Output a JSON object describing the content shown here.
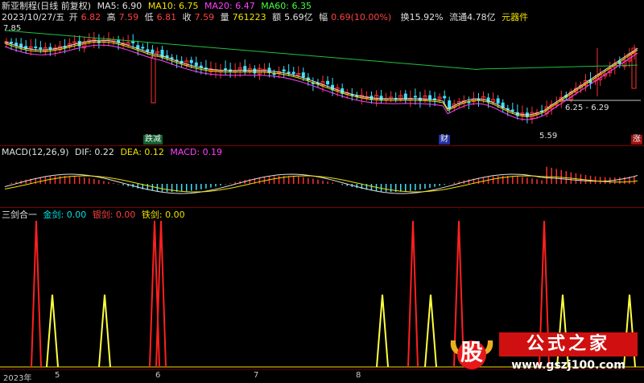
{
  "title": "新亚制程(日线 前复权)",
  "ma": {
    "ma5": "MA5: 6.90",
    "ma10": "MA10: 6.75",
    "ma20": "MA20: 6.47",
    "ma60": "MA60: 6.35"
  },
  "quote": {
    "date": "2023/10/27/五",
    "open_label": "开",
    "open": "6.82",
    "high_label": "高",
    "high": "7.59",
    "low_label": "低",
    "low": "6.81",
    "close_label": "收",
    "close": "7.59",
    "vol_label": "量",
    "vol": "761223",
    "amt_label": "额",
    "amt": "5.69亿",
    "chg_label": "幅",
    "chg": "0.69(10.00%)",
    "turnover": "换15.92%",
    "float": "流通4.78亿",
    "sector": "元器件"
  },
  "price_labels": {
    "top": "7.85",
    "range": "6.25 - 6.29",
    "low": "5.59"
  },
  "tags": {
    "t1": "跌减",
    "t2": "财",
    "t3": "涨"
  },
  "macd": {
    "name": "MACD(12,26,9)",
    "dif": "DIF: 0.22",
    "dea": "DEA: 0.12",
    "macd": "MACD: 0.19"
  },
  "sword": {
    "name": "三剑合一",
    "gold": "金剑: 0.00",
    "silver": "银剑: 0.00",
    "iron": "铁剑: 0.00"
  },
  "dates": {
    "year": "2023年",
    "m5": "5",
    "m6": "6",
    "m7": "7",
    "m8": "8"
  },
  "logo": {
    "gu": "股",
    "text": "公式之家",
    "url": "www.gszj100.com"
  },
  "colors": {
    "red": "#ff2020",
    "yellow": "#ffff40",
    "cyan": "#40e0ff",
    "magenta": "#ff40ff",
    "green": "#20c040",
    "bg": "#000000",
    "grid": "#800000"
  }
}
